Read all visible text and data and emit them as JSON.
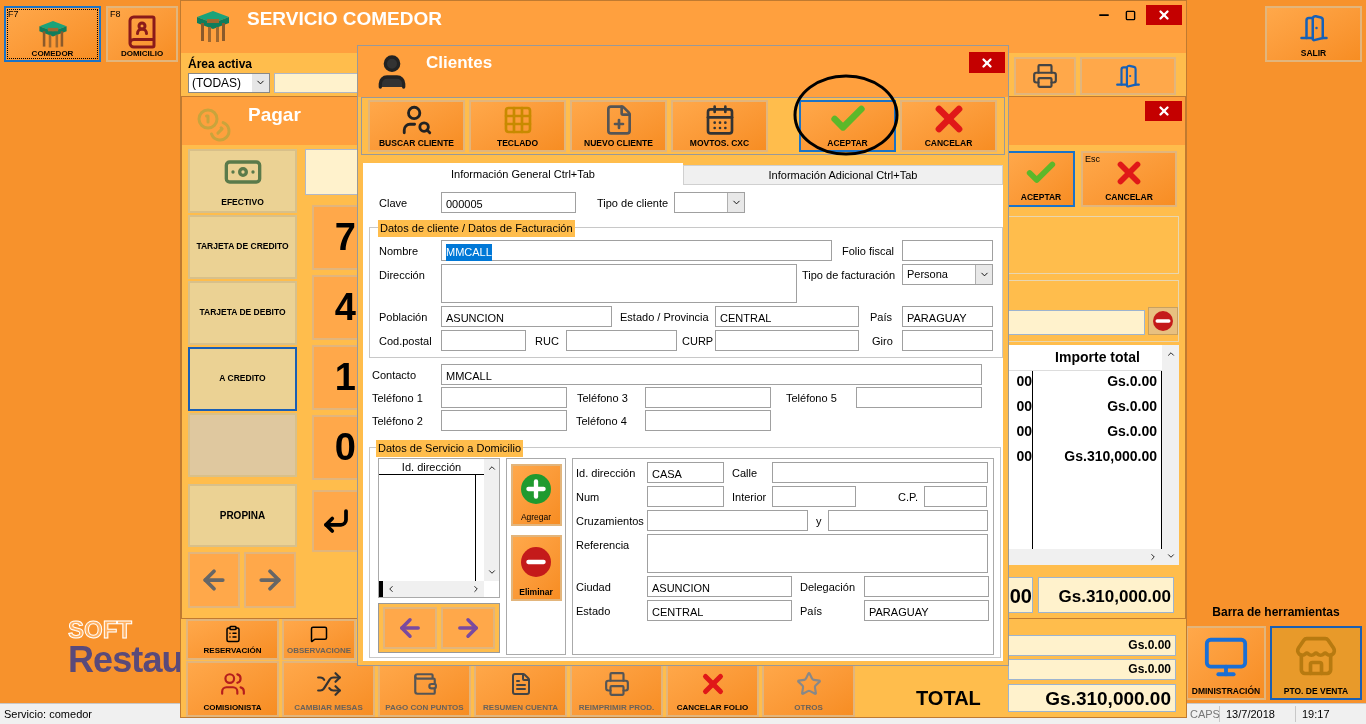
{
  "desktop": {
    "launchers": [
      {
        "key": "F7",
        "label": "COMEDOR",
        "selected": true
      },
      {
        "key": "F8",
        "label": "DOMICILIO",
        "selected": false
      }
    ],
    "exit_button": {
      "label": "SALIR"
    },
    "logo": {
      "line1": "SOFT",
      "line2": "Restau"
    },
    "tools": {
      "title": "Barra de herramientas",
      "items": [
        {
          "label": "DMINISTRACIÓN",
          "selected": false
        },
        {
          "label": "PTO. DE VENTA",
          "selected": true
        }
      ]
    },
    "status_bar": {
      "service": "Servicio: comedor",
      "caps": "CAPS",
      "date": "13/7/2018",
      "time": "19:17"
    }
  },
  "service_window": {
    "title": "SERVICIO COMEDOR",
    "area_label": "Área activa",
    "area_value": "(TODAS)",
    "action_rows": [
      [
        {
          "label": "RESERVACIÓN",
          "disabled": false
        },
        {
          "label": "OBSERVACIONE",
          "disabled": true
        }
      ],
      [
        {
          "label": "COMISIONISTA",
          "disabled": false
        },
        {
          "label": "CAMBIAR MESAS",
          "disabled": true
        },
        {
          "label": "PAGO CON PUNTOS",
          "disabled": true
        },
        {
          "label": "RESUMEN CUENTA",
          "disabled": true
        },
        {
          "label": "REIMPRIMIR PROD.",
          "disabled": true
        },
        {
          "label": "CANCELAR FOLIO",
          "disabled": false
        },
        {
          "label": "OTROS",
          "disabled": true
        }
      ]
    ],
    "subtotals": [
      "Gs.0.00",
      "Gs.0.00"
    ],
    "total_label": "TOTAL",
    "total": "Gs.310,000.00"
  },
  "pay_window": {
    "title": "Pagar",
    "methods": [
      {
        "kind": "method",
        "label": "EFECTIVO",
        "selected": false
      },
      {
        "kind": "method",
        "label": "TARJETA DE CREDITO",
        "selected": false
      },
      {
        "kind": "method",
        "label": "TARJETA DE DEBITO",
        "selected": false
      },
      {
        "kind": "method",
        "label": "A CREDITO",
        "selected": true
      },
      {
        "kind": "blank"
      }
    ],
    "tip_button": "PROPINA",
    "keys": [
      "7",
      "4",
      "1",
      "0"
    ],
    "accept": {
      "label": "ACEPTAR",
      "focused": true
    },
    "cancel": {
      "label": "CANCELAR",
      "hotkey": "Esc"
    },
    "table": {
      "columns": [
        "",
        "Importe total"
      ],
      "rows": [
        [
          "00",
          "Gs.0.00"
        ],
        [
          "00",
          "Gs.0.00"
        ],
        [
          "00",
          "Gs.0.00"
        ],
        [
          "00",
          "Gs.310,000.00"
        ]
      ]
    },
    "totals": [
      "00",
      "Gs.310,000.00"
    ]
  },
  "clientes": {
    "title": "Clientes",
    "toolbar": [
      {
        "label": "BUSCAR CLIENTE",
        "focused": false
      },
      {
        "label": "TECLADO",
        "focused": false
      },
      {
        "label": "NUEVO CLIENTE",
        "focused": false
      },
      {
        "label": "MOVTOS. CXC",
        "focused": false
      },
      {
        "label": "ACEPTAR",
        "focused": true
      },
      {
        "label": "CANCELAR",
        "focused": false
      }
    ],
    "tabs": [
      {
        "label": "Información General Ctrl+Tab",
        "selected": true
      },
      {
        "label": "Información Adicional Ctrl+Tab",
        "selected": false
      }
    ],
    "top_fields": [
      {
        "kind": "text",
        "label": "Clave",
        "value": "000005"
      },
      {
        "kind": "select",
        "label": "Tipo de cliente"
      }
    ],
    "billing": {
      "legend": "Datos de cliente / Datos de Facturación",
      "fields": [
        {
          "kind": "text",
          "label": "Nombre",
          "value": "MMCALL",
          "text_selected": true
        },
        {
          "kind": "text",
          "label": "Folio fiscal"
        },
        {
          "kind": "textarea",
          "label": "Dirección"
        },
        {
          "kind": "select",
          "label": "Tipo de facturación",
          "value": "Persona"
        },
        {
          "kind": "text",
          "label": "Población",
          "value": "ASUNCION"
        },
        {
          "kind": "text",
          "label": "Estado / Provincia",
          "value": "CENTRAL"
        },
        {
          "kind": "text",
          "label": "País",
          "value": "PARAGUAY"
        },
        {
          "kind": "text",
          "label": "Cod.postal"
        },
        {
          "kind": "text",
          "label": "RUC"
        },
        {
          "kind": "text",
          "label": "CURP"
        },
        {
          "kind": "text",
          "label": "Giro"
        }
      ]
    },
    "contact_fields": [
      {
        "kind": "text",
        "label": "Contacto",
        "value": "MMCALL"
      },
      {
        "kind": "text",
        "label": "Teléfono 1"
      },
      {
        "kind": "text",
        "label": "Teléfono 3"
      },
      {
        "kind": "text",
        "label": "Teléfono 5"
      },
      {
        "kind": "text",
        "label": "Teléfono 2"
      },
      {
        "kind": "text",
        "label": "Teléfono 4"
      }
    ],
    "delivery": {
      "legend": "Datos de Servicio a Domicilio",
      "list_column": "Id. dirección",
      "add_button": "Agregar",
      "remove_button": "Eliminar",
      "fields": [
        {
          "kind": "text",
          "label": "Id. dirección",
          "value": "CASA"
        },
        {
          "kind": "text",
          "label": "Calle"
        },
        {
          "kind": "text",
          "label": "Num"
        },
        {
          "kind": "text",
          "label": "Interior"
        },
        {
          "kind": "text",
          "label": "C.P."
        },
        {
          "kind": "text",
          "label": "Cruzamientos"
        },
        {
          "kind": "text",
          "label": "y"
        },
        {
          "kind": "textarea",
          "label": "Referencia"
        },
        {
          "kind": "text",
          "label": "Ciudad",
          "value": "ASUNCION"
        },
        {
          "kind": "text",
          "label": "Delegación"
        },
        {
          "kind": "text",
          "label": "Estado",
          "value": "CENTRAL"
        },
        {
          "kind": "text",
          "label": "País",
          "value": "PARAGUAY"
        }
      ]
    }
  }
}
